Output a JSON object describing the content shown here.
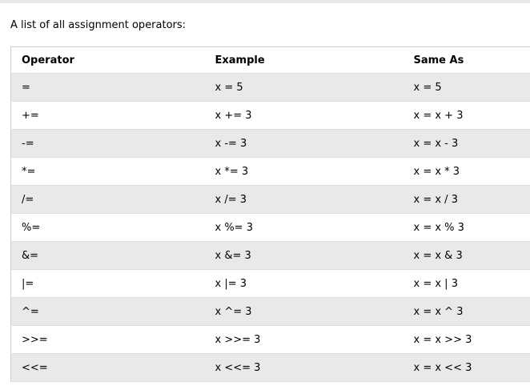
{
  "intro_text": "A list of all assignment operators:",
  "colors": {
    "row_shade": "#e7e9eb",
    "border": "#dddddd"
  },
  "table": {
    "headers": [
      "Operator",
      "Example",
      "Same As"
    ],
    "rows": [
      [
        "=",
        "x = 5",
        "x = 5"
      ],
      [
        "+=",
        "x += 3",
        "x = x + 3"
      ],
      [
        "-=",
        "x -= 3",
        "x = x - 3"
      ],
      [
        "*=",
        "x *= 3",
        "x = x * 3"
      ],
      [
        "/=",
        "x /= 3",
        "x = x / 3"
      ],
      [
        "%=",
        "x %= 3",
        "x = x % 3"
      ],
      [
        "&=",
        "x &= 3",
        "x = x & 3"
      ],
      [
        "|=",
        "x |= 3",
        "x = x | 3"
      ],
      [
        "^=",
        "x ^= 3",
        "x = x ^ 3"
      ],
      [
        ">>=",
        "x >>= 3",
        "x = x >> 3"
      ],
      [
        "<<=",
        "x <<= 3",
        "x = x << 3"
      ]
    ]
  }
}
